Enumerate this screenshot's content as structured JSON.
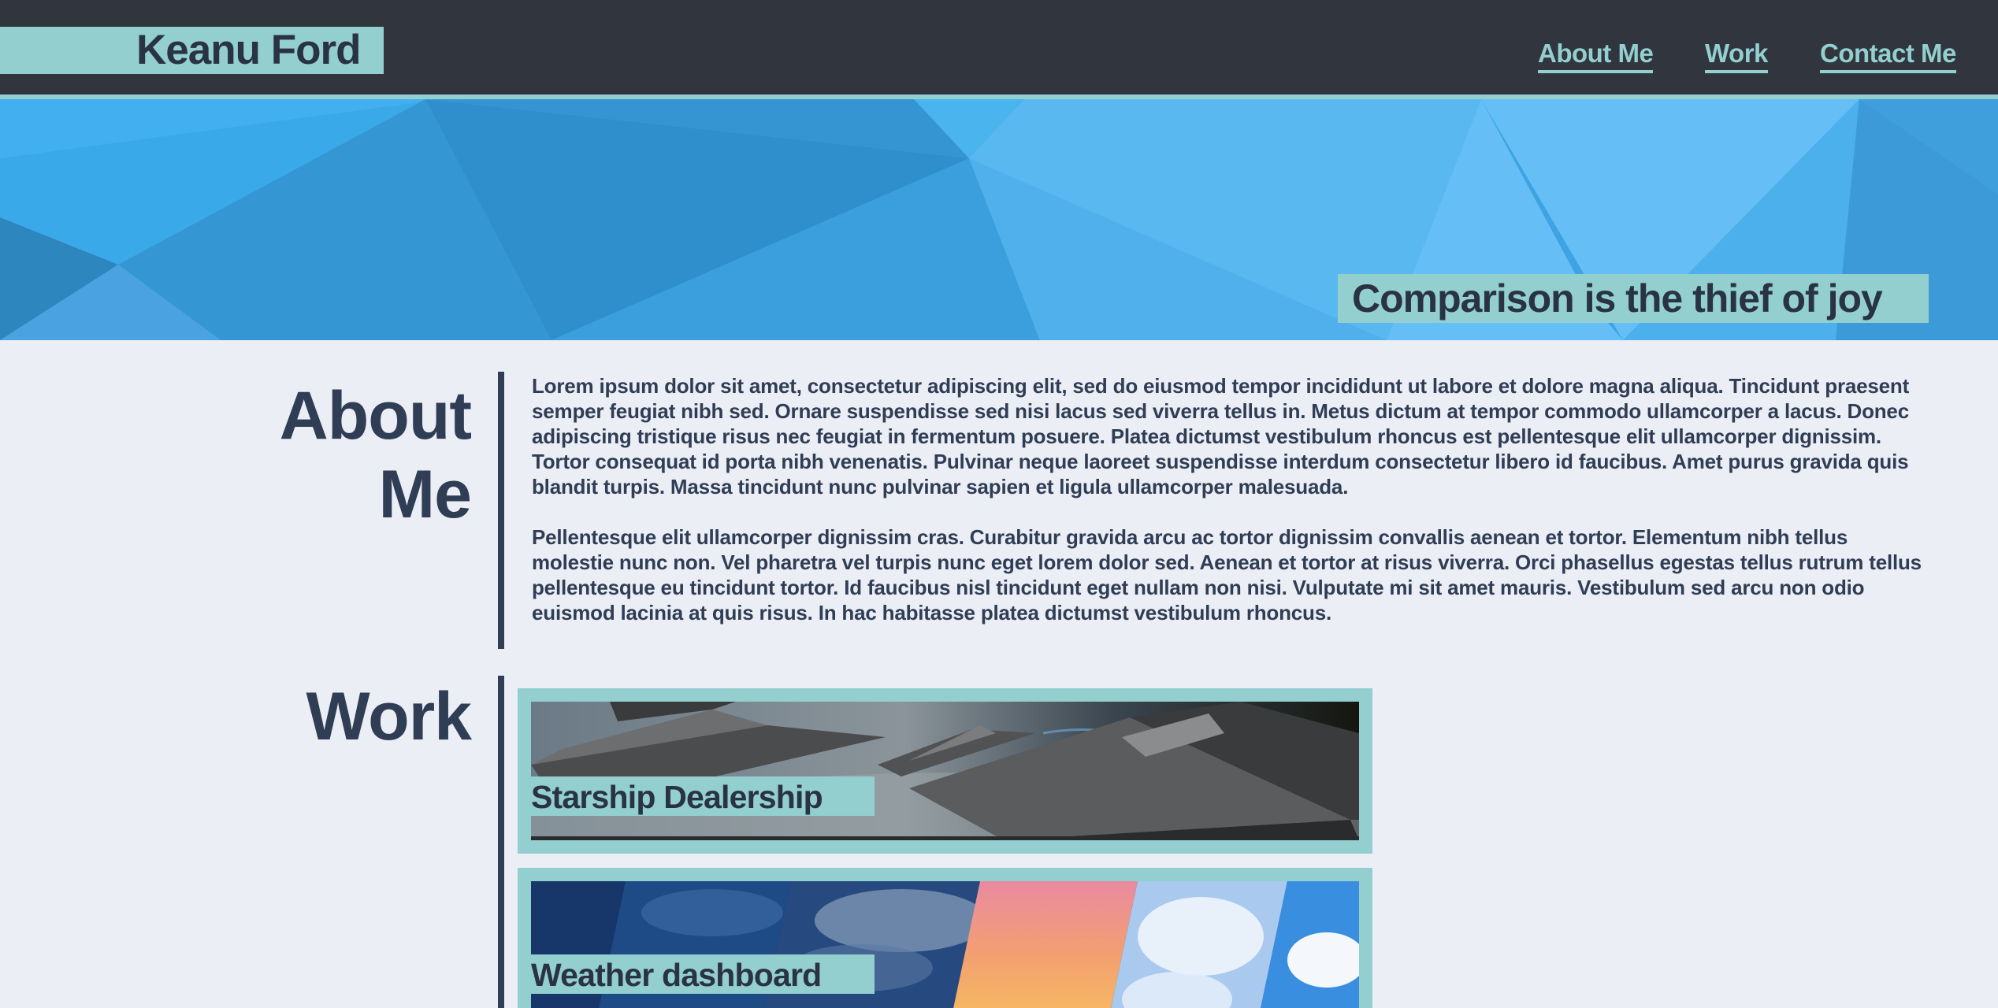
{
  "header": {
    "brand": "Keanu Ford",
    "nav": [
      {
        "label": "About Me"
      },
      {
        "label": "Work"
      },
      {
        "label": "Contact Me"
      }
    ]
  },
  "hero": {
    "tagline": "Comparison is the thief of joy"
  },
  "about": {
    "title_line1": "About",
    "title_line2": "Me",
    "paragraphs": [
      "Lorem ipsum dolor sit amet, consectetur adipiscing elit, sed do eiusmod tempor incididunt ut labore et dolore magna aliqua. Tincidunt praesent semper feugiat nibh sed. Ornare suspendisse sed nisi lacus sed viverra tellus in. Metus dictum at tempor commodo ullamcorper a lacus. Donec adipiscing tristique risus nec feugiat in fermentum posuere. Platea dictumst vestibulum rhoncus est pellentesque elit ullamcorper dignissim. Tortor consequat id porta nibh venenatis. Pulvinar neque laoreet suspendisse interdum consectetur libero id faucibus. Amet purus gravida quis blandit turpis. Massa tincidunt nunc pulvinar sapien et ligula ullamcorper malesuada.",
      "Pellentesque elit ullamcorper dignissim cras. Curabitur gravida arcu ac tortor dignissim convallis aenean et tortor. Elementum nibh tellus molestie nunc non. Vel pharetra vel turpis nunc eget lorem dolor sed. Aenean et tortor at risus viverra. Orci phasellus egestas tellus rutrum tellus pellentesque eu tincidunt tortor. Id faucibus nisl tincidunt eget nullam non nisi. Vulputate mi sit amet mauris. Vestibulum sed arcu non odio euismod lacinia at quis risus. In hac habitasse platea dictumst vestibulum rhoncus."
    ]
  },
  "work": {
    "title": "Work",
    "projects": [
      {
        "label": "Starship Dealership"
      },
      {
        "label": "Weather dashboard"
      }
    ]
  },
  "colors": {
    "header_bg": "#31353e",
    "accent": "#93cfcf",
    "page_bg": "#eceef5",
    "text": "#2f3d55"
  }
}
